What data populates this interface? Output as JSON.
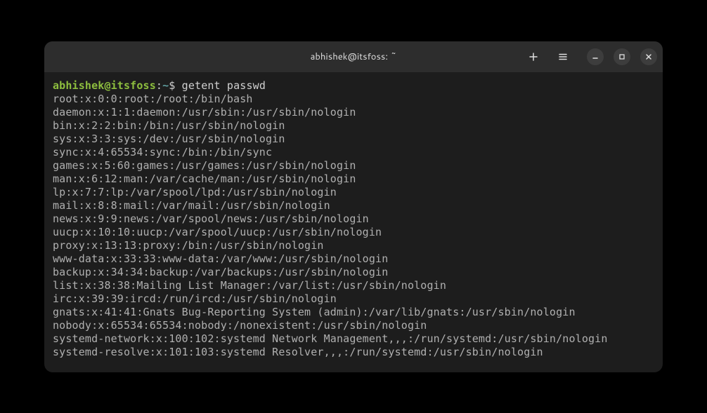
{
  "window": {
    "title": "abhishek@itsfoss: ~"
  },
  "prompt": {
    "user_host": "abhishek@itsfoss",
    "colon": ":",
    "path": "~",
    "symbol": "$",
    "command": "getent passwd"
  },
  "output": {
    "l0": "root:x:0:0:root:/root:/bin/bash",
    "l1": "daemon:x:1:1:daemon:/usr/sbin:/usr/sbin/nologin",
    "l2": "bin:x:2:2:bin:/bin:/usr/sbin/nologin",
    "l3": "sys:x:3:3:sys:/dev:/usr/sbin/nologin",
    "l4": "sync:x:4:65534:sync:/bin:/bin/sync",
    "l5": "games:x:5:60:games:/usr/games:/usr/sbin/nologin",
    "l6": "man:x:6:12:man:/var/cache/man:/usr/sbin/nologin",
    "l7": "lp:x:7:7:lp:/var/spool/lpd:/usr/sbin/nologin",
    "l8": "mail:x:8:8:mail:/var/mail:/usr/sbin/nologin",
    "l9": "news:x:9:9:news:/var/spool/news:/usr/sbin/nologin",
    "l10": "uucp:x:10:10:uucp:/var/spool/uucp:/usr/sbin/nologin",
    "l11": "proxy:x:13:13:proxy:/bin:/usr/sbin/nologin",
    "l12": "www-data:x:33:33:www-data:/var/www:/usr/sbin/nologin",
    "l13": "backup:x:34:34:backup:/var/backups:/usr/sbin/nologin",
    "l14": "list:x:38:38:Mailing List Manager:/var/list:/usr/sbin/nologin",
    "l15": "irc:x:39:39:ircd:/run/ircd:/usr/sbin/nologin",
    "l16": "gnats:x:41:41:Gnats Bug-Reporting System (admin):/var/lib/gnats:/usr/sbin/nologin",
    "l17": "nobody:x:65534:65534:nobody:/nonexistent:/usr/sbin/nologin",
    "l18": "systemd-network:x:100:102:systemd Network Management,,,:/run/systemd:/usr/sbin/nologin",
    "l19": "systemd-resolve:x:101:103:systemd Resolver,,,:/run/systemd:/usr/sbin/nologin"
  }
}
